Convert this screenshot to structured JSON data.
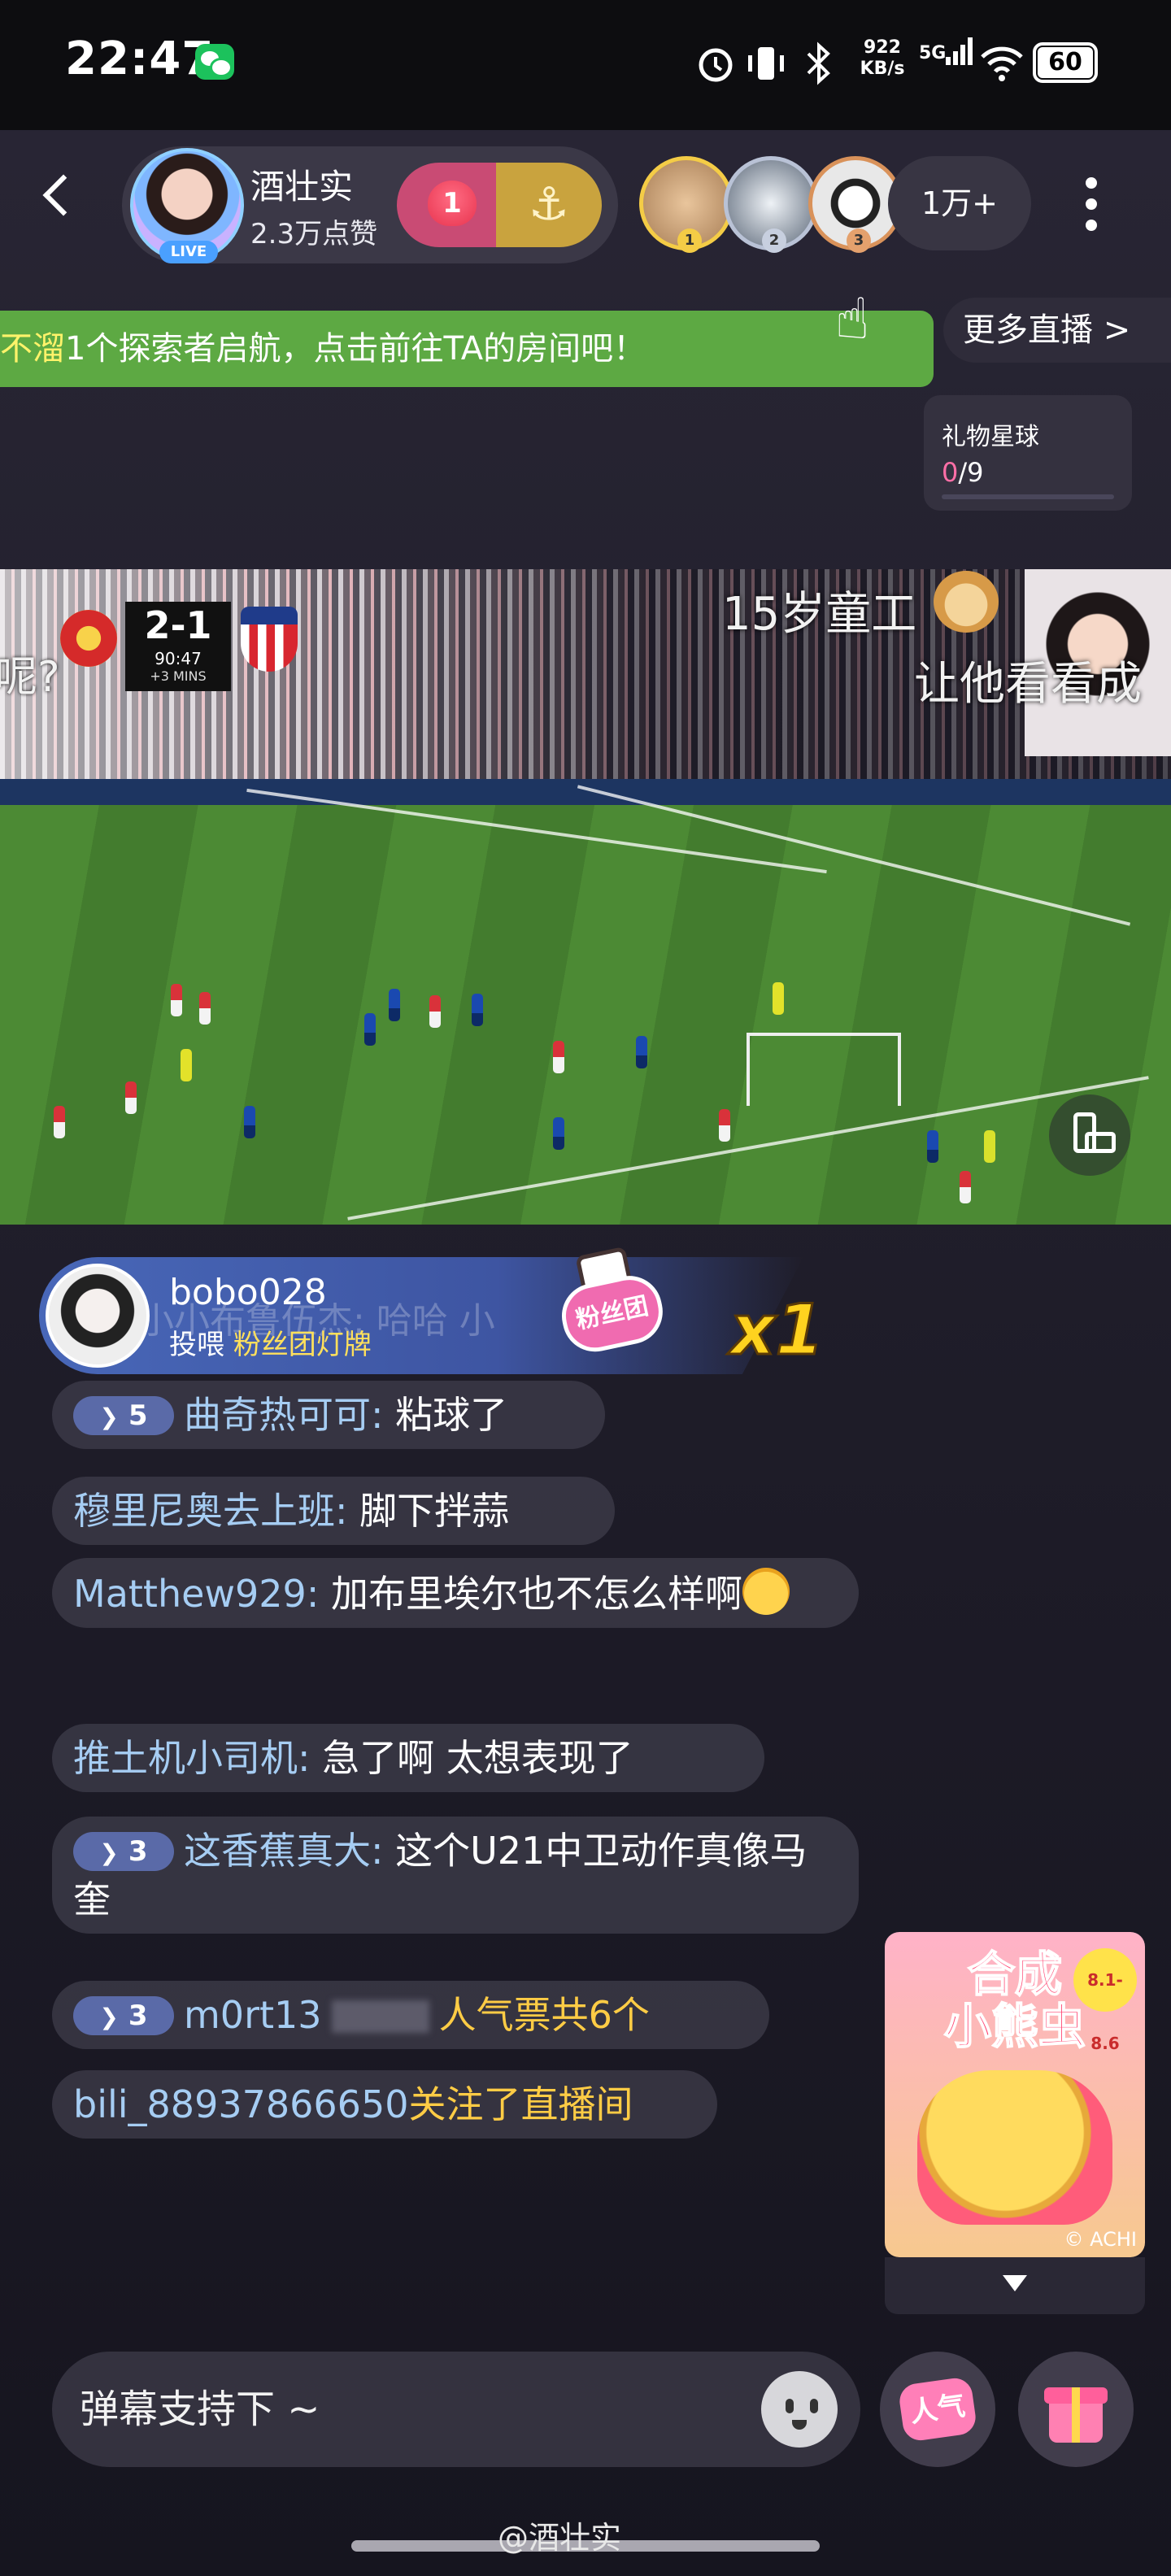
{
  "status_bar": {
    "time": "22:47",
    "net_speed": "922\nKB/s",
    "signal": "5G",
    "battery": "60"
  },
  "header": {
    "anchor_name": "酒壮实",
    "anchor_likes": "2.3万点赞",
    "live_badge": "LIVE",
    "fan_badge": "1",
    "top_ranks": [
      "1",
      "2",
      "3"
    ],
    "viewer_count": "1万+"
  },
  "banner": {
    "highlight": "不溜",
    "text": "1个探索者启航，点击前往TA的房间吧！"
  },
  "more_live": "更多直播 >",
  "gift_planet": {
    "title": "礼物星球",
    "current": "0",
    "total": "/9"
  },
  "video": {
    "scorebug": {
      "score": "2-1",
      "time": "90:47",
      "added": "+3 MINS"
    },
    "captions": {
      "left": "呢?",
      "top": "15岁童工",
      "right": "让他看看成"
    }
  },
  "gift_notice": {
    "user": "bobo028",
    "action": "投喂",
    "item": "粉丝团灯牌",
    "icon_text": "粉丝团",
    "multiplier": "x1",
    "ghost": "小小布鲁伍杰: 哈哈 小"
  },
  "chat": [
    {
      "level": "5",
      "user": "曲奇热可可:",
      "text": " 粘球了"
    },
    {
      "user": "穆里尼奥去上班:",
      "text": " 脚下拌蒜"
    },
    {
      "user": "Matthew929:",
      "text": " 加布里埃尔也不怎么样啊"
    },
    {
      "user": "推土机小司机:",
      "text": " 急了啊 太想表现了"
    },
    {
      "level": "3",
      "user": "这香蕉真大:",
      "text": " 这个U21中卫动作真像马奎"
    },
    {
      "level": "3",
      "user": "m0rt13",
      "text": "人气票共6个"
    },
    {
      "user": "bili_88937866650",
      "text": "关注了直播间"
    }
  ],
  "promo": {
    "title": "合成\n小熊虫",
    "date": "8.1-8.6",
    "copyright": "© ACHI"
  },
  "input": {
    "placeholder": "弹幕支持下 ~"
  },
  "popularity_label": "人气",
  "watermark": "@酒壮实"
}
